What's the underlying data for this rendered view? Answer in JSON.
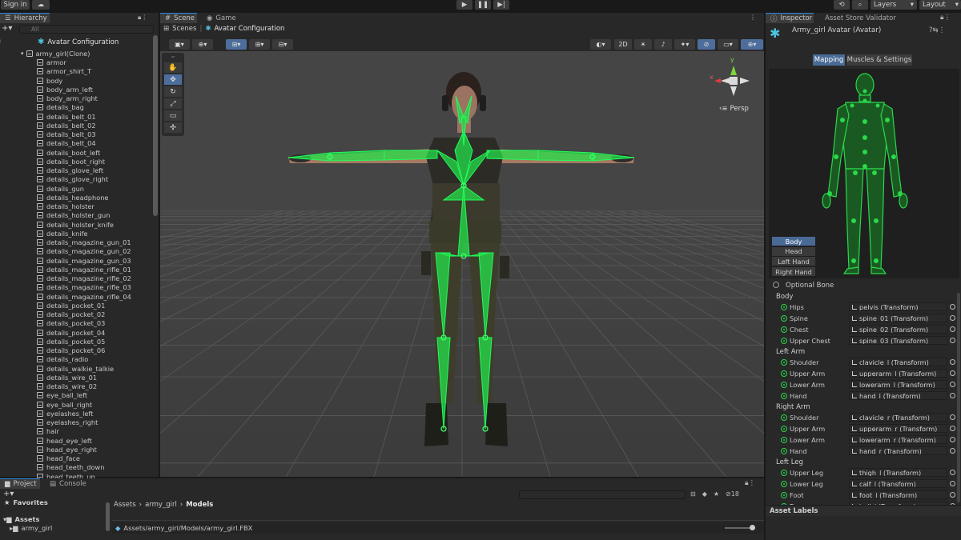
{
  "topbar": {
    "sign_in": "Sign in",
    "layers": "Layers",
    "layout": "Layout"
  },
  "hierarchy": {
    "tab": "Hierarchy",
    "search_placeholder": "All",
    "header": "Avatar Configuration",
    "root": "army_girl(Clone)",
    "items": [
      "armor",
      "armor_shirt_T",
      "body",
      "body_arm_left",
      "body_arm_right",
      "details_bag",
      "details_belt_01",
      "details_belt_02",
      "details_belt_03",
      "details_belt_04",
      "details_boot_left",
      "details_boot_right",
      "details_glove_left",
      "details_glove_right",
      "details_gun",
      "details_headphone",
      "details_holster",
      "details_holster_gun",
      "details_holster_knife",
      "details_knife",
      "details_magazine_gun_01",
      "details_magazine_gun_02",
      "details_magazine_gun_03",
      "details_magazine_rifle_01",
      "details_magazine_rifle_02",
      "details_magazine_rifle_03",
      "details_magazine_rifle_04",
      "details_pocket_01",
      "details_pocket_02",
      "details_pocket_03",
      "details_pocket_04",
      "details_pocket_05",
      "details_pocket_06",
      "details_radio",
      "details_walkie_talkie",
      "details_wire_01",
      "details_wire_02",
      "eye_ball_left",
      "eye_ball_right",
      "eyelashes_left",
      "eyelashes_right",
      "hair",
      "head_eye_left",
      "head_eye_right",
      "head_face",
      "head_teeth_down",
      "head_teeth_up"
    ]
  },
  "scene": {
    "tab_scene": "Scene",
    "tab_game": "Game",
    "breadcrumb_scenes": "Scenes",
    "breadcrumb_current": "Avatar Configuration",
    "btn_2d": "2D",
    "persp": "Persp",
    "gizmo_y": "y",
    "gizmo_x": "x"
  },
  "inspector": {
    "tab_inspector": "Inspector",
    "tab_validator": "Asset Store Validator",
    "title": "Army_girl Avatar (Avatar)",
    "mapping": "Mapping",
    "muscles": "Muscles & Settings",
    "parts": [
      "Body",
      "Head",
      "Left Hand",
      "Right Hand"
    ],
    "optional_bone": "Optional Bone",
    "groups": [
      {
        "name": "Body",
        "bones": [
          [
            "Hips",
            "pelvis (Transform)"
          ],
          [
            "Spine",
            "spine_01 (Transform)"
          ],
          [
            "Chest",
            "spine_02 (Transform)"
          ],
          [
            "Upper Chest",
            "spine_03 (Transform)"
          ]
        ]
      },
      {
        "name": "Left Arm",
        "bones": [
          [
            "Shoulder",
            "clavicle_l (Transform)"
          ],
          [
            "Upper Arm",
            "upperarm_l (Transform)"
          ],
          [
            "Lower Arm",
            "lowerarm_l (Transform)"
          ],
          [
            "Hand",
            "hand_l (Transform)"
          ]
        ]
      },
      {
        "name": "Right Arm",
        "bones": [
          [
            "Shoulder",
            "clavicle_r (Transform)"
          ],
          [
            "Upper Arm",
            "upperarm_r (Transform)"
          ],
          [
            "Lower Arm",
            "lowerarm_r (Transform)"
          ],
          [
            "Hand",
            "hand_r (Transform)"
          ]
        ]
      },
      {
        "name": "Left Leg",
        "bones": [
          [
            "Upper Leg",
            "thigh_l (Transform)"
          ],
          [
            "Lower Leg",
            "calf_l (Transform)"
          ],
          [
            "Foot",
            "foot_l (Transform)"
          ],
          [
            "Toes",
            "ball_l (Transform)"
          ]
        ]
      }
    ],
    "asset_labels": "Asset Labels"
  },
  "project": {
    "tab_project": "Project",
    "tab_console": "Console",
    "favorites": "Favorites",
    "assets": "Assets",
    "army_girl": "army_girl",
    "crumbs": [
      "Assets",
      "army_girl",
      "Models"
    ],
    "file_path": "Assets/army_girl/Models/army_girl.FBX",
    "hidden_count": "18"
  },
  "colors": {
    "accent": "#2ad84a",
    "selected": "#4a6a96"
  }
}
